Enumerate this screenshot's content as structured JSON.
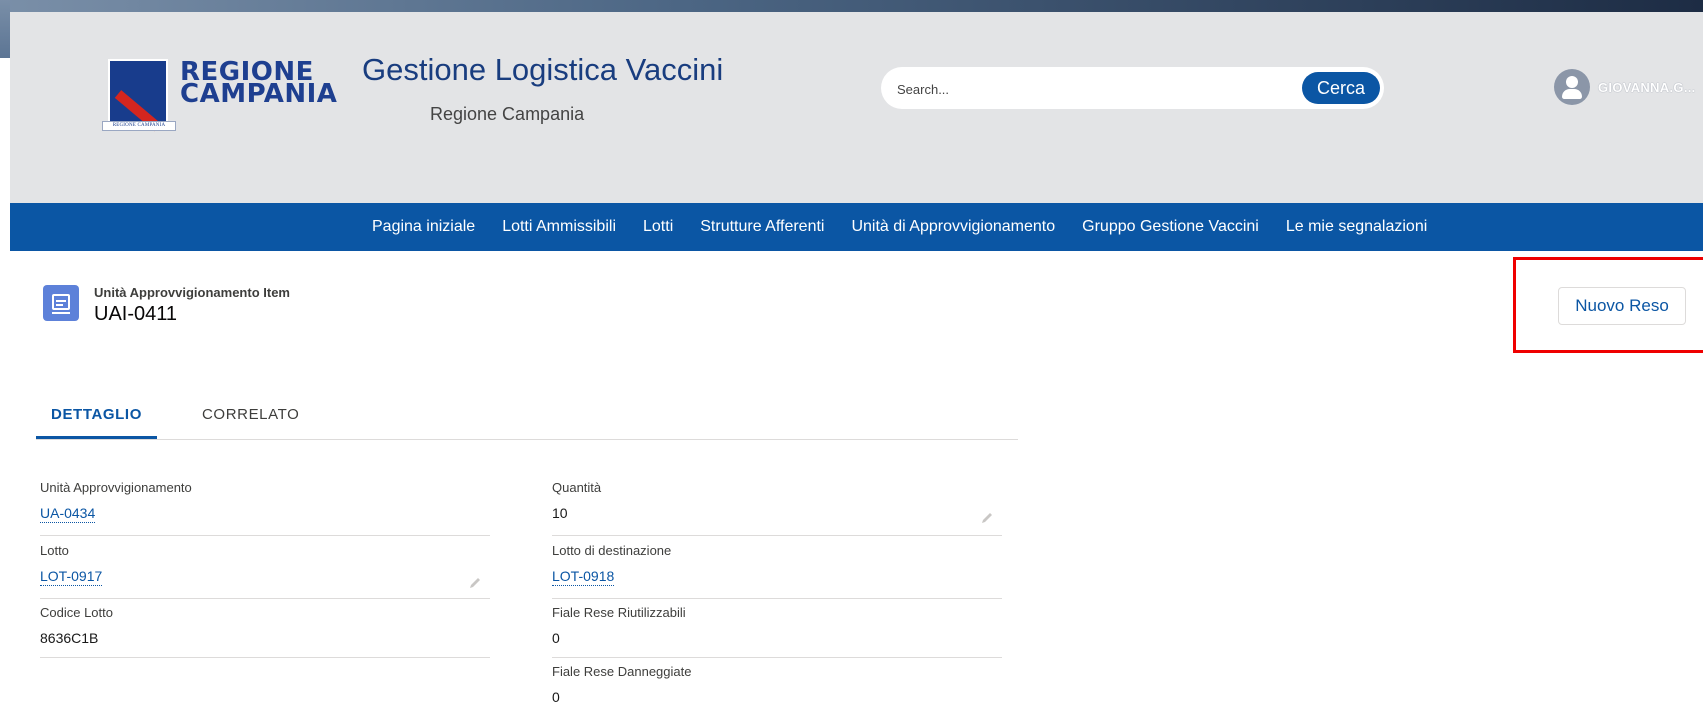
{
  "header": {
    "logo_line1": "REGIONE",
    "logo_line2": "CAMPANIA",
    "logo_caption": "REGIONE CAMPANIA",
    "app_title": "Gestione Logistica Vaccini",
    "app_subtitle": "Regione Campania"
  },
  "search": {
    "placeholder": "Search...",
    "button_label": "Cerca"
  },
  "user": {
    "name": "GIOVANNA.G...",
    "avatar_icon": "user-avatar-icon",
    "menu_icon": "chevron-down-icon"
  },
  "nav": {
    "items": [
      "Pagina iniziale",
      "Lotti Ammissibili",
      "Lotti",
      "Strutture Afferenti",
      "Unità di Approvvigionamento",
      "Gruppo Gestione Vaccini",
      "Le mie segnalazioni"
    ]
  },
  "record": {
    "type_label": "Unità Approvvigionamento Item",
    "name": "UAI-0411",
    "icon": "record-document-icon",
    "action_button": "Nuovo Reso"
  },
  "tabs": [
    "DETTAGLIO",
    "CORRELATO"
  ],
  "fields": {
    "unita_label": "Unità Approvvigionamento",
    "unita_value": "UA-0434",
    "lotto_label": "Lotto",
    "lotto_value": "LOT-0917",
    "codice_label": "Codice Lotto",
    "codice_value": "8636C1B",
    "quantita_label": "Quantità",
    "quantita_value": "10",
    "destinazione_label": "Lotto di destinazione",
    "destinazione_value": "LOT-0918",
    "riutilizzabili_label": "Fiale Rese Riutilizzabili",
    "riutilizzabili_value": "0",
    "danneggiate_label": "Fiale Rese Danneggiate",
    "danneggiate_value": "0"
  },
  "colors": {
    "brand_blue": "#0b56a4",
    "header_bg": "#e3e4e6",
    "highlight_red": "#ef0000"
  }
}
